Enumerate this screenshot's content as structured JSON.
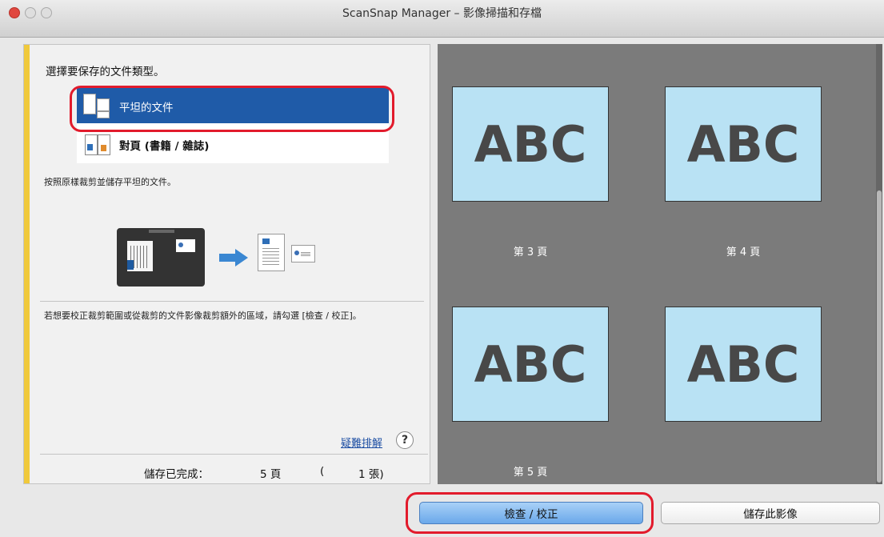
{
  "window": {
    "title": "ScanSnap Manager – 影像掃描和存檔"
  },
  "left": {
    "heading": "選擇要保存的文件類型。",
    "doc_types": [
      {
        "label": "平坦的文件",
        "icon": "flat-document-icon",
        "selected": true
      },
      {
        "label": "對頁 (書籍 / 雜誌)",
        "icon": "book-spread-icon",
        "selected": false
      }
    ],
    "description": "按照原樣裁剪並儲存平坦的文件。",
    "hint": "若想要校正裁剪範圍或從裁剪的文件影像裁剪額外的區域，請勾選 [檢查 / 校正]。",
    "troubleshoot_link": "疑難排解",
    "help_symbol": "?",
    "status": {
      "label": "儲存已完成：",
      "pages": "5 頁",
      "paren_open": "(",
      "sheets": "1 張)"
    }
  },
  "preview": {
    "thumbnails": [
      {
        "text": "ABC"
      },
      {
        "text": "ABC"
      },
      {
        "text": "ABC"
      },
      {
        "text": "ABC"
      }
    ],
    "page_labels": [
      "第 3 頁",
      "第 4 頁",
      "第 5 頁"
    ]
  },
  "buttons": {
    "check": "檢查 / 校正",
    "save": "儲存此影像"
  },
  "colors": {
    "selection": "#1f5ba8",
    "highlight_outline": "#e21b2c",
    "accent_bar": "#f0c93b",
    "preview_bg": "#7b7b7b",
    "thumbnail_bg": "#b9e2f4"
  }
}
